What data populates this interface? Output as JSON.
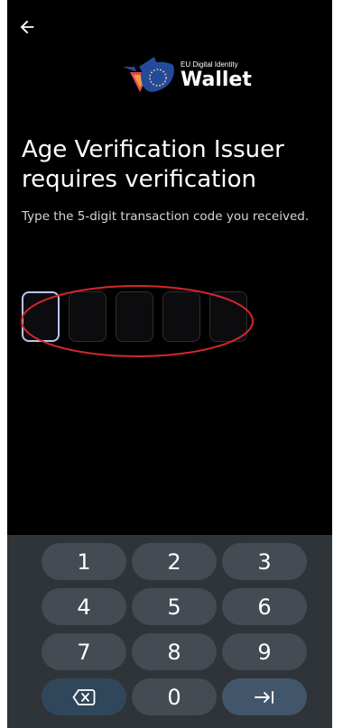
{
  "header": {
    "back_icon": "arrow-left-icon"
  },
  "logo": {
    "small_text": "EU Digital Identity",
    "big_text": "Wallet",
    "colors": {
      "blue": "#244b9b",
      "orange": "#f39c42",
      "red": "#df4d4d",
      "star": "#f7d56b"
    }
  },
  "main": {
    "title": "Age Verification Issuer requires verification",
    "subtitle": "Type the 5-digit transaction code you received."
  },
  "code_input": {
    "digits": 5,
    "active_index": 0
  },
  "keyboard": {
    "keys": [
      "1",
      "2",
      "3",
      "4",
      "5",
      "6",
      "7",
      "8",
      "9",
      "",
      "0",
      ""
    ],
    "special_keys": {
      "backspace": "backspace-icon",
      "enter": "tab-enter-icon"
    }
  },
  "colors": {
    "background": "#000000",
    "text": "#ffffff",
    "active_box_border": "#b9c7ee",
    "box_border": "#2e2e33",
    "annotation": "#d5272c",
    "keyboard_background": "#2f3438",
    "key_background": "#454b52"
  }
}
